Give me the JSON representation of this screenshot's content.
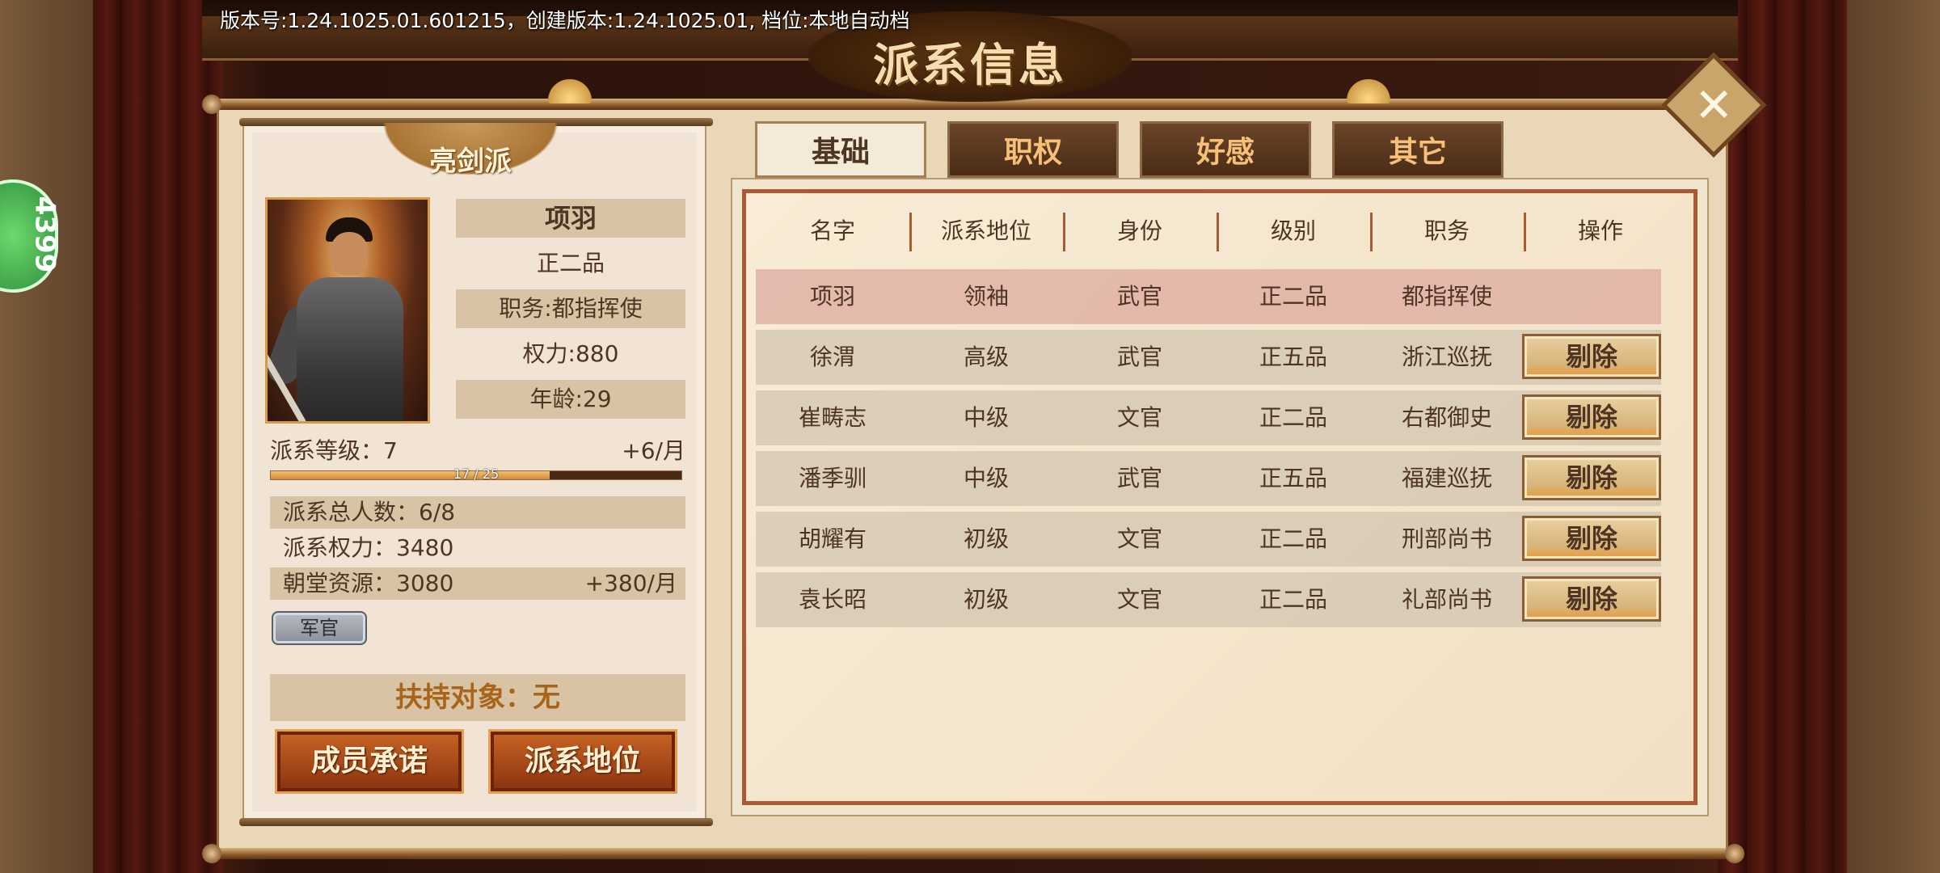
{
  "version_text": "版本号:1.24.1025.01.601215，创建版本:1.24.1025.01, 档位:本地自动档",
  "title": "派系信息",
  "close_icon": "✕",
  "side_badge": "4399",
  "faction": {
    "name": "亮剑派",
    "leader_name": "项羽",
    "rank": "正二品",
    "position": "职务:都指挥使",
    "power": "权力:880",
    "age": "年龄:29",
    "level_label": "派系等级：7",
    "level_rate": "+6/月",
    "exp_text": "17 / 25",
    "exp_progress": 0.68,
    "members": "派系总人数：6/8",
    "faction_power": "派系权力：3480",
    "resources": "朝堂资源：3080",
    "resources_rate": "+380/月",
    "tag": "军官",
    "support": "扶持对象：无",
    "btn_commit": "成员承诺",
    "btn_status": "派系地位"
  },
  "tabs": [
    "基础",
    "职权",
    "好感",
    "其它"
  ],
  "table": {
    "headers": [
      "名字",
      "派系地位",
      "身份",
      "级别",
      "职务",
      "操作"
    ],
    "rows": [
      {
        "name": "项羽",
        "status": "领袖",
        "identity": "武官",
        "level": "正二品",
        "duty": "都指挥使",
        "action": ""
      },
      {
        "name": "徐渭",
        "status": "高级",
        "identity": "武官",
        "level": "正五品",
        "duty": "浙江巡抚",
        "action": "剔除"
      },
      {
        "name": "崔畴志",
        "status": "中级",
        "identity": "文官",
        "level": "正二品",
        "duty": "右都御史",
        "action": "剔除"
      },
      {
        "name": "潘季驯",
        "status": "中级",
        "identity": "武官",
        "level": "正五品",
        "duty": "福建巡抚",
        "action": "剔除"
      },
      {
        "name": "胡耀有",
        "status": "初级",
        "identity": "文官",
        "level": "正二品",
        "duty": "刑部尚书",
        "action": "剔除"
      },
      {
        "name": "袁长昭",
        "status": "初级",
        "identity": "文官",
        "level": "正二品",
        "duty": "礼部尚书",
        "action": "剔除"
      }
    ]
  }
}
